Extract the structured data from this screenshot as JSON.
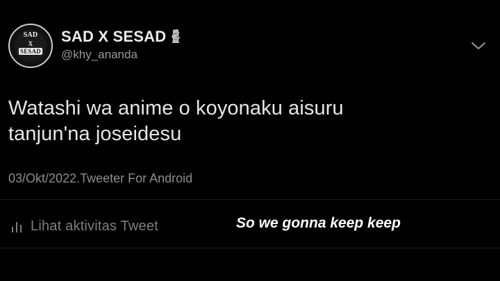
{
  "profile": {
    "avatar_lines": [
      "SAD",
      "X",
      "SESAD"
    ],
    "display_name": "SAD X SESAD",
    "name_emoji_icon": "moai-icon",
    "handle": "@khy_ananda"
  },
  "tweet": {
    "text_lines": [
      "Watashi wa anime o koyonaku aisuru",
      "tanjun'na joseidesu"
    ],
    "meta": "03/Okt/2022.Tweeter For Android",
    "menu_icon": "chevron-down-icon"
  },
  "actions": {
    "activity_icon": "bar-chart-icon",
    "activity_label": "Lihat aktivitas Tweet"
  },
  "overlay": {
    "subtitle": "So we gonna keep keep"
  },
  "colors": {
    "background": "#000000",
    "text_primary": "#e6e6e6",
    "text_secondary": "#8e8e8e",
    "divider": "#1e1e1e"
  }
}
